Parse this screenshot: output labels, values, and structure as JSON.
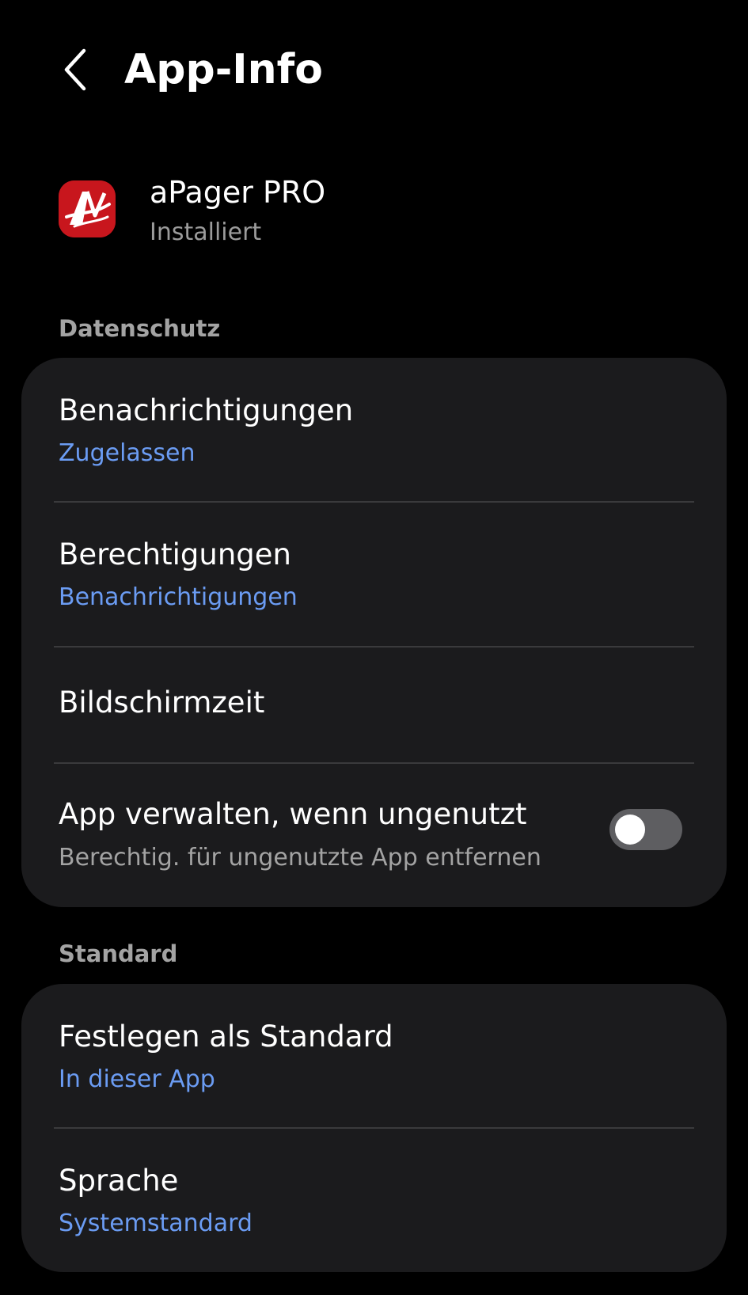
{
  "header": {
    "title": "App-Info",
    "back_icon": "chevron-left-icon"
  },
  "app": {
    "name": "aPager PRO",
    "status": "Installiert",
    "icon": "apager-logo-icon",
    "icon_color": "#c8161d"
  },
  "sections": {
    "privacy": {
      "label": "Datenschutz",
      "items": [
        {
          "title": "Benachrichtigungen",
          "subtitle": "Zugelassen"
        },
        {
          "title": "Berechtigungen",
          "subtitle": "Benachrichtigungen"
        },
        {
          "title": "Bildschirmzeit"
        },
        {
          "title": "App verwalten, wenn ungenutzt",
          "subtitle": "Berechtig. für ungenutzte App entfernen",
          "toggle_on": false
        }
      ]
    },
    "defaults": {
      "label": "Standard",
      "items": [
        {
          "title": "Festlegen als Standard",
          "subtitle": "In dieser App"
        },
        {
          "title": "Sprache",
          "subtitle": "Systemstandard"
        }
      ]
    }
  },
  "colors": {
    "background": "#000000",
    "card": "#1b1b1d",
    "accent_link": "#6b9cf3",
    "secondary_text": "#a3a3a3",
    "toggle_off_track": "#5e5e61"
  }
}
